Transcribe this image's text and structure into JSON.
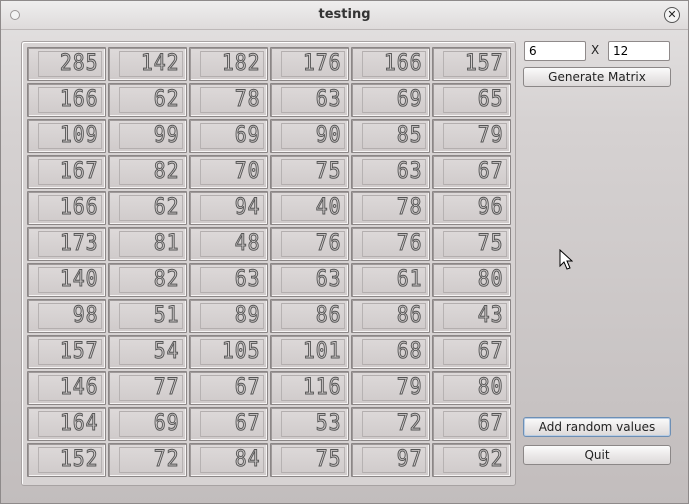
{
  "window": {
    "title": "testing"
  },
  "controls": {
    "rows_value": "6",
    "cols_value": "12",
    "x_label": "X",
    "generate_label": "Generate Matrix",
    "add_random_label": "Add random values",
    "quit_label": "Quit"
  },
  "matrix": [
    [
      "285",
      "142",
      "182",
      "176",
      "166",
      "157"
    ],
    [
      "166",
      "62",
      "78",
      "63",
      "69",
      "65"
    ],
    [
      "109",
      "99",
      "69",
      "90",
      "85",
      "79"
    ],
    [
      "167",
      "82",
      "70",
      "75",
      "63",
      "67"
    ],
    [
      "166",
      "62",
      "94",
      "40",
      "78",
      "96"
    ],
    [
      "173",
      "81",
      "48",
      "76",
      "76",
      "75"
    ],
    [
      "140",
      "82",
      "63",
      "63",
      "61",
      "80"
    ],
    [
      "98",
      "51",
      "89",
      "86",
      "86",
      "43"
    ],
    [
      "157",
      "54",
      "105",
      "101",
      "68",
      "67"
    ],
    [
      "146",
      "77",
      "67",
      "116",
      "79",
      "80"
    ],
    [
      "164",
      "69",
      "67",
      "53",
      "72",
      "67"
    ],
    [
      "152",
      "72",
      "84",
      "75",
      "97",
      "92"
    ]
  ]
}
